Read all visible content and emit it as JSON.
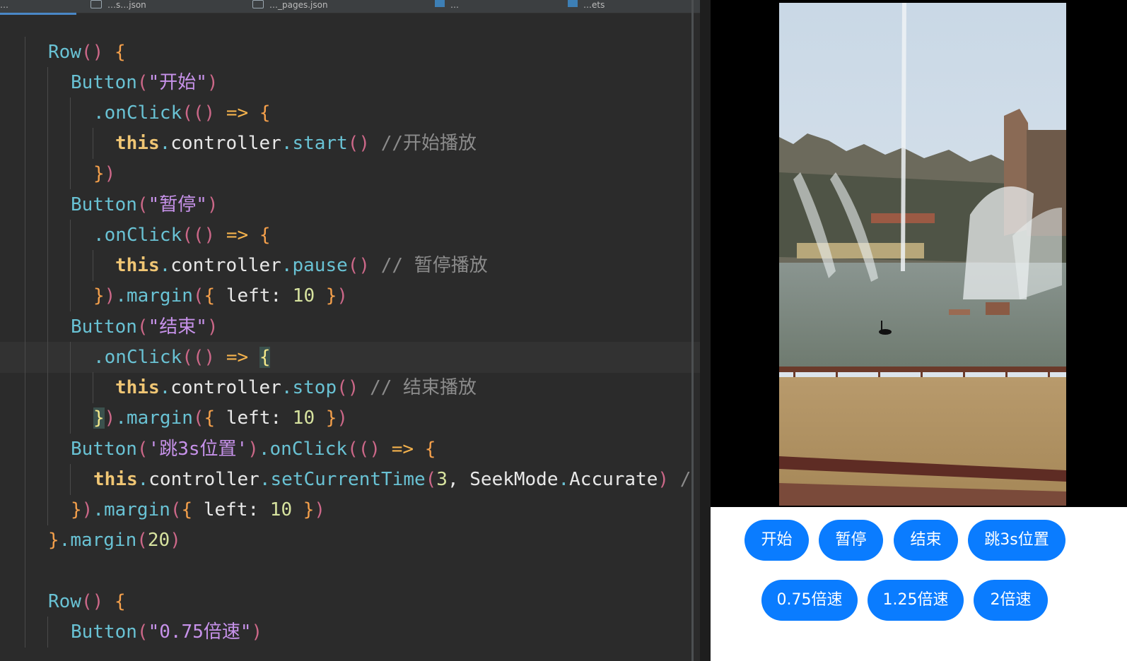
{
  "editor": {
    "tabs": [
      {
        "label": "…",
        "icon": "none"
      },
      {
        "label": "…s…json",
        "icon": "json-file-icon"
      },
      {
        "label": "…_pages.json",
        "icon": "json-file-icon"
      },
      {
        "label": "…",
        "icon": "ets-file-icon"
      },
      {
        "label": "…ets",
        "icon": "ets-file-icon"
      }
    ],
    "code": {
      "row1": "Row",
      "button_fn": "Button",
      "start_label": "\"开始\"",
      "pause_label": "\"暂停\"",
      "stop_label": "\"结束\"",
      "seek_label": "'跳3s位置'",
      "speed_label": "\"0.75倍速\"",
      "onclick": ".onClick",
      "this_kw": "this",
      "controller": "controller",
      "start_method": "start",
      "pause_method": "pause",
      "stop_method": "stop",
      "seek_method": "setCurrentTime",
      "margin": "margin",
      "left_key": "left",
      "ten": "10",
      "three": "3",
      "twenty": "20",
      "seekmode": "SeekMode",
      "accurate": "Accurate",
      "comment_start": "//开始播放",
      "comment_pause": "// 暂停播放",
      "comment_stop": "// 结束播放",
      "comment_seek": "/"
    }
  },
  "preview": {
    "buttons_row1": [
      "开始",
      "暂停",
      "结束",
      "跳3s位置"
    ],
    "buttons_row2": [
      "0.75倍速",
      "1.25倍速",
      "2倍速"
    ],
    "accent_color": "#0a7cff"
  }
}
